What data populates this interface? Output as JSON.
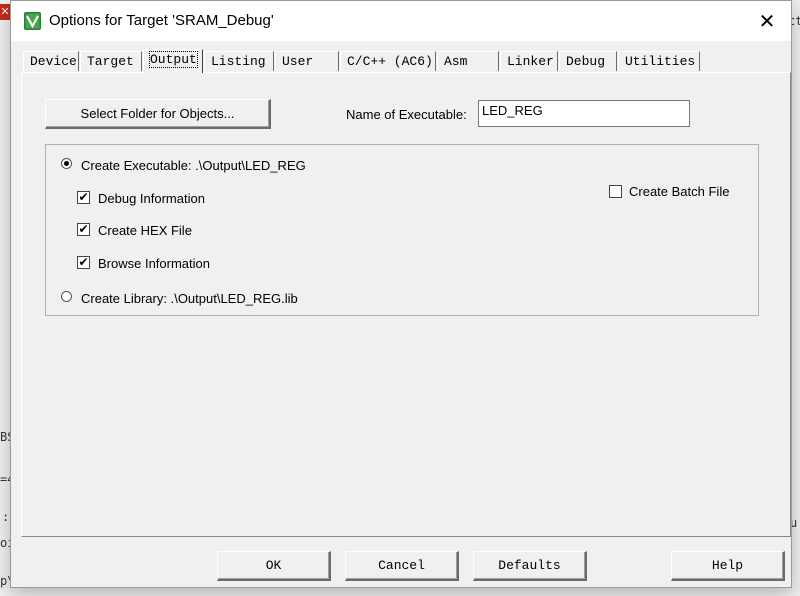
{
  "window": {
    "title": "Options for Target 'SRAM_Debug'",
    "close_glyph": "✕"
  },
  "tabs": [
    {
      "label": "Device"
    },
    {
      "label": "Target"
    },
    {
      "label": "Output"
    },
    {
      "label": "Listing"
    },
    {
      "label": "User"
    },
    {
      "label": "C/C++ (AC6)"
    },
    {
      "label": "Asm"
    },
    {
      "label": "Linker"
    },
    {
      "label": "Debug"
    },
    {
      "label": "Utilities"
    }
  ],
  "active_tab": "Output",
  "output": {
    "select_folder_label": "Select Folder for Objects...",
    "name_exe_label": "Name of Executable:",
    "name_exe_value": "LED_REG",
    "create_exe_label": "Create Executable:  .\\Output\\LED_REG",
    "create_exe_selected": true,
    "debug_info_label": "Debug Information",
    "debug_info_checked": true,
    "create_hex_label": "Create HEX File",
    "create_hex_checked": true,
    "browse_info_label": "Browse Information",
    "browse_info_checked": true,
    "create_batch_label": "Create Batch File",
    "create_batch_checked": false,
    "create_lib_label": "Create Library:  .\\Output\\LED_REG.lib",
    "create_lib_selected": false
  },
  "footer": {
    "ok": "OK",
    "cancel": "Cancel",
    "defaults": "Defaults",
    "help": "Help"
  },
  "icons": {
    "app": "keil-uvision-icon",
    "check_mark": "✔"
  },
  "background": {
    "red_box_glyph": "✕",
    "left_glyphs": [
      "BS",
      "=4",
      ":",
      "oi",
      "p\\"
    ],
    "right_glyphs": [
      "ct",
      "u"
    ]
  }
}
